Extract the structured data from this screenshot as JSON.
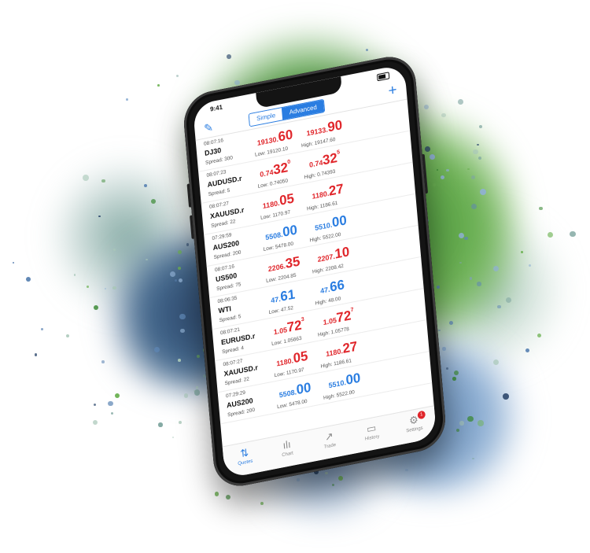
{
  "status": {
    "time": "9:41"
  },
  "toolbar": {
    "segment_simple": "Simple",
    "segment_advanced": "Advanced",
    "add": "+"
  },
  "quotes": [
    {
      "time": "08:07:16",
      "symbol": "DJ30",
      "spread": "Spread: 300",
      "bid_main": "19130.",
      "bid_big": "60",
      "bid_sup": "",
      "bid_color": "red",
      "ask_main": "19133.",
      "ask_big": "90",
      "ask_sup": "",
      "ask_color": "red",
      "low": "Low: 19120.10",
      "high": "High: 19147.60"
    },
    {
      "time": "08:07:23",
      "symbol": "AUDUSD.r",
      "spread": "Spread: 5",
      "bid_main": "0.74",
      "bid_big": "32",
      "bid_sup": "0",
      "bid_color": "red",
      "ask_main": "0.74",
      "ask_big": "32",
      "ask_sup": "5",
      "ask_color": "red",
      "low": "Low: 0.74050",
      "high": "High: 0.74393"
    },
    {
      "time": "08:07:27",
      "symbol": "XAUUSD.r",
      "spread": "Spread: 22",
      "bid_main": "1180.",
      "bid_big": "05",
      "bid_sup": "",
      "bid_color": "red",
      "ask_main": "1180.",
      "ask_big": "27",
      "ask_sup": "",
      "ask_color": "red",
      "low": "Low: 1170.97",
      "high": "High: 1186.61"
    },
    {
      "time": "07:29:59",
      "symbol": "AUS200",
      "spread": "Spread: 200",
      "bid_main": "5508.",
      "bid_big": "00",
      "bid_sup": "",
      "bid_color": "blue",
      "ask_main": "5510.",
      "ask_big": "00",
      "ask_sup": "",
      "ask_color": "blue",
      "low": "Low: 5478.00",
      "high": "High: 5522.00"
    },
    {
      "time": "08:07:16",
      "symbol": "US500",
      "spread": "Spread: 75",
      "bid_main": "2206.",
      "bid_big": "35",
      "bid_sup": "",
      "bid_color": "red",
      "ask_main": "2207.",
      "ask_big": "10",
      "ask_sup": "",
      "ask_color": "red",
      "low": "Low: 2204.85",
      "high": "High: 2208.42"
    },
    {
      "time": "08:06:35",
      "symbol": "WTI",
      "spread": "Spread: 5",
      "bid_main": "47.",
      "bid_big": "61",
      "bid_sup": "",
      "bid_color": "blue",
      "ask_main": "47.",
      "ask_big": "66",
      "ask_sup": "",
      "ask_color": "blue",
      "low": "Low: 47.52",
      "high": "High: 48.00"
    },
    {
      "time": "08:07:21",
      "symbol": "EURUSD.r",
      "spread": "Spread: 4",
      "bid_main": "1.05",
      "bid_big": "72",
      "bid_sup": "3",
      "bid_color": "red",
      "ask_main": "1.05",
      "ask_big": "72",
      "ask_sup": "7",
      "ask_color": "red",
      "low": "Low: 1.05663",
      "high": "High: 1.05778"
    },
    {
      "time": "08:07:27",
      "symbol": "XAUUSD.r",
      "spread": "Spread: 22",
      "bid_main": "1180.",
      "bid_big": "05",
      "bid_sup": "",
      "bid_color": "red",
      "ask_main": "1180.",
      "ask_big": "27",
      "ask_sup": "",
      "ask_color": "red",
      "low": "Low: 1170.97",
      "high": "High: 1186.61"
    },
    {
      "time": "07:29:29",
      "symbol": "AUS200",
      "spread": "Spread: 200",
      "bid_main": "5508.",
      "bid_big": "00",
      "bid_sup": "",
      "bid_color": "blue",
      "ask_main": "5510.",
      "ask_big": "00",
      "ask_sup": "",
      "ask_color": "blue",
      "low": "Low: 5478.00",
      "high": "High: 5522.00"
    }
  ],
  "tabs": [
    {
      "label": "Quotes",
      "icon": "quotes-icon",
      "active": true
    },
    {
      "label": "Chart",
      "icon": "chart-icon",
      "active": false
    },
    {
      "label": "Trade",
      "icon": "trade-icon",
      "active": false
    },
    {
      "label": "History",
      "icon": "history-icon",
      "active": false
    },
    {
      "label": "Settings",
      "icon": "settings-icon",
      "active": false,
      "badge": "1"
    }
  ],
  "colors": {
    "accent": "#2a7de1",
    "price_down": "#e0262b",
    "green_splash": "#4f9a3f",
    "blue_splash": "#456a8f"
  }
}
